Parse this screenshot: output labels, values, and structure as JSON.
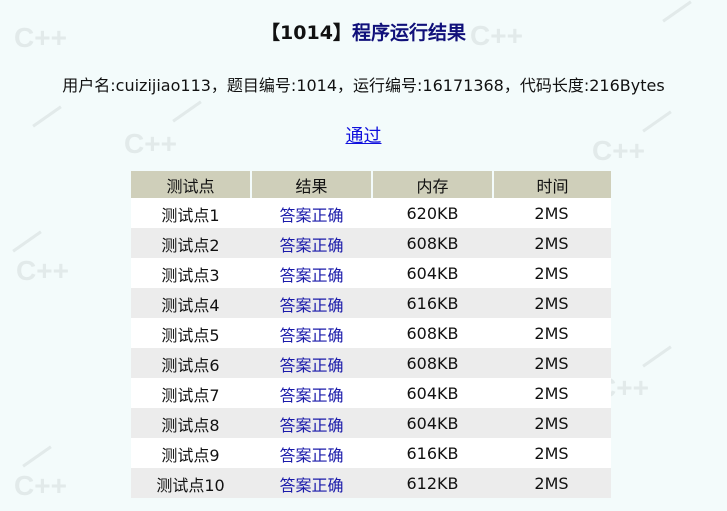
{
  "header": {
    "problem_id_bracket": "【1014】",
    "title": "程序运行结果"
  },
  "info_line": "用户名:cuizijiao113，题目编号:1014，运行编号:16171368，代码长度:216Bytes",
  "status_link": "通过",
  "table": {
    "columns": [
      "测试点",
      "结果",
      "内存",
      "时间"
    ],
    "rows": [
      {
        "test": "测试点1",
        "result": "答案正确",
        "memory": "620KB",
        "time": "2MS"
      },
      {
        "test": "测试点2",
        "result": "答案正确",
        "memory": "608KB",
        "time": "2MS"
      },
      {
        "test": "测试点3",
        "result": "答案正确",
        "memory": "604KB",
        "time": "2MS"
      },
      {
        "test": "测试点4",
        "result": "答案正确",
        "memory": "616KB",
        "time": "2MS"
      },
      {
        "test": "测试点5",
        "result": "答案正确",
        "memory": "608KB",
        "time": "2MS"
      },
      {
        "test": "测试点6",
        "result": "答案正确",
        "memory": "608KB",
        "time": "2MS"
      },
      {
        "test": "测试点7",
        "result": "答案正确",
        "memory": "604KB",
        "time": "2MS"
      },
      {
        "test": "测试点8",
        "result": "答案正确",
        "memory": "604KB",
        "time": "2MS"
      },
      {
        "test": "测试点9",
        "result": "答案正确",
        "memory": "616KB",
        "time": "2MS"
      },
      {
        "test": "测试点10",
        "result": "答案正确",
        "memory": "612KB",
        "time": "2MS"
      }
    ]
  },
  "colors": {
    "title": "#10107a",
    "link": "#1010dd",
    "result_text": "#1a1aaa",
    "header_bg": "#cfcfba",
    "page_bg": "#f3fbfb"
  }
}
